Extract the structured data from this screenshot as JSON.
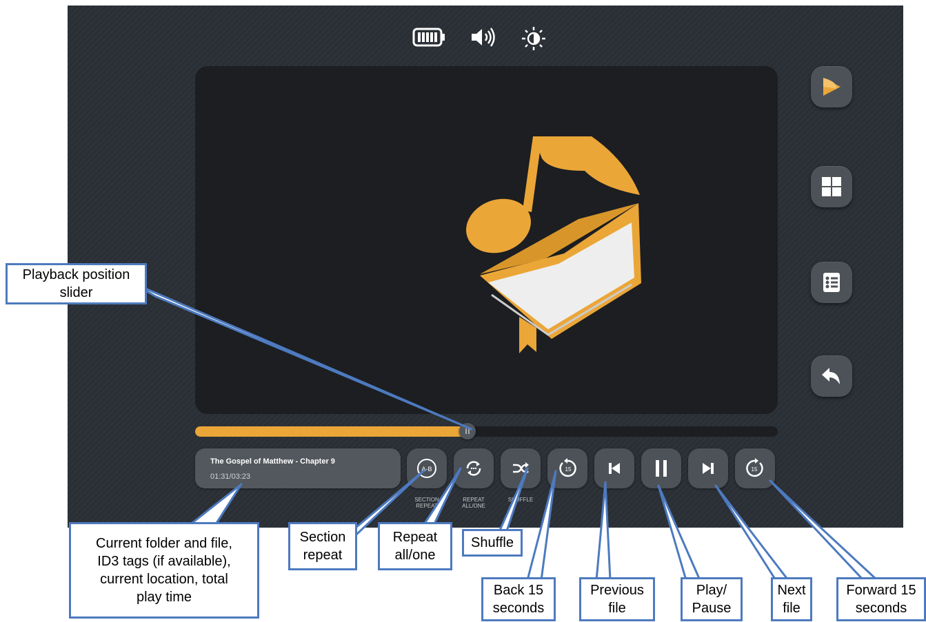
{
  "status_bar": {
    "icons": [
      "battery-icon",
      "volume-icon",
      "brightness-icon"
    ]
  },
  "album_art": {
    "icon": "music-book-icon",
    "accent": "#eba638"
  },
  "side_menu": [
    {
      "name": "logo-button",
      "icon": "app-logo-icon"
    },
    {
      "name": "grid-view-button",
      "icon": "grid-icon"
    },
    {
      "name": "list-view-button",
      "icon": "list-icon"
    },
    {
      "name": "back-button",
      "icon": "back-arrow-icon"
    }
  ],
  "playback": {
    "progress": 0.4675
  },
  "now_playing": {
    "title": "The Gospel of Matthew - Chapter 9",
    "time": "01:31/03:23"
  },
  "controls": {
    "section_repeat": {
      "label_line1": "SECTION",
      "label_line2": "REPEAT",
      "icon_text": "A-B"
    },
    "repeat": {
      "label_line1": "REPEAT",
      "label_line2": "ALL/ONE"
    },
    "shuffle": {
      "label": "SHUFFLE"
    },
    "back15": {
      "icon_text": "15"
    },
    "forward15": {
      "icon_text": "15"
    }
  },
  "callouts": {
    "slider": {
      "line1": "Playback position",
      "line2": "slider"
    },
    "info": {
      "line1": "Current folder and file,",
      "line2": "ID3 tags (if available),",
      "line3": "current location, total",
      "line4": "play time"
    },
    "section": {
      "line1": "Section",
      "line2": "repeat"
    },
    "repeat": {
      "line1": "Repeat",
      "line2": "all/one"
    },
    "shuffle": {
      "line1": "Shuffle"
    },
    "back15": {
      "line1": "Back 15",
      "line2": "seconds"
    },
    "prev": {
      "line1": "Previous",
      "line2": "file"
    },
    "play": {
      "line1": "Play/",
      "line2": "Pause"
    },
    "next": {
      "line1": "Next",
      "line2": "file"
    },
    "forward15": {
      "line1": "Forward 15",
      "line2": "seconds"
    }
  },
  "colors": {
    "callout_border": "#4d7abf",
    "accent": "#eba638",
    "panel": "#53585e",
    "background": "#2a2f35"
  }
}
